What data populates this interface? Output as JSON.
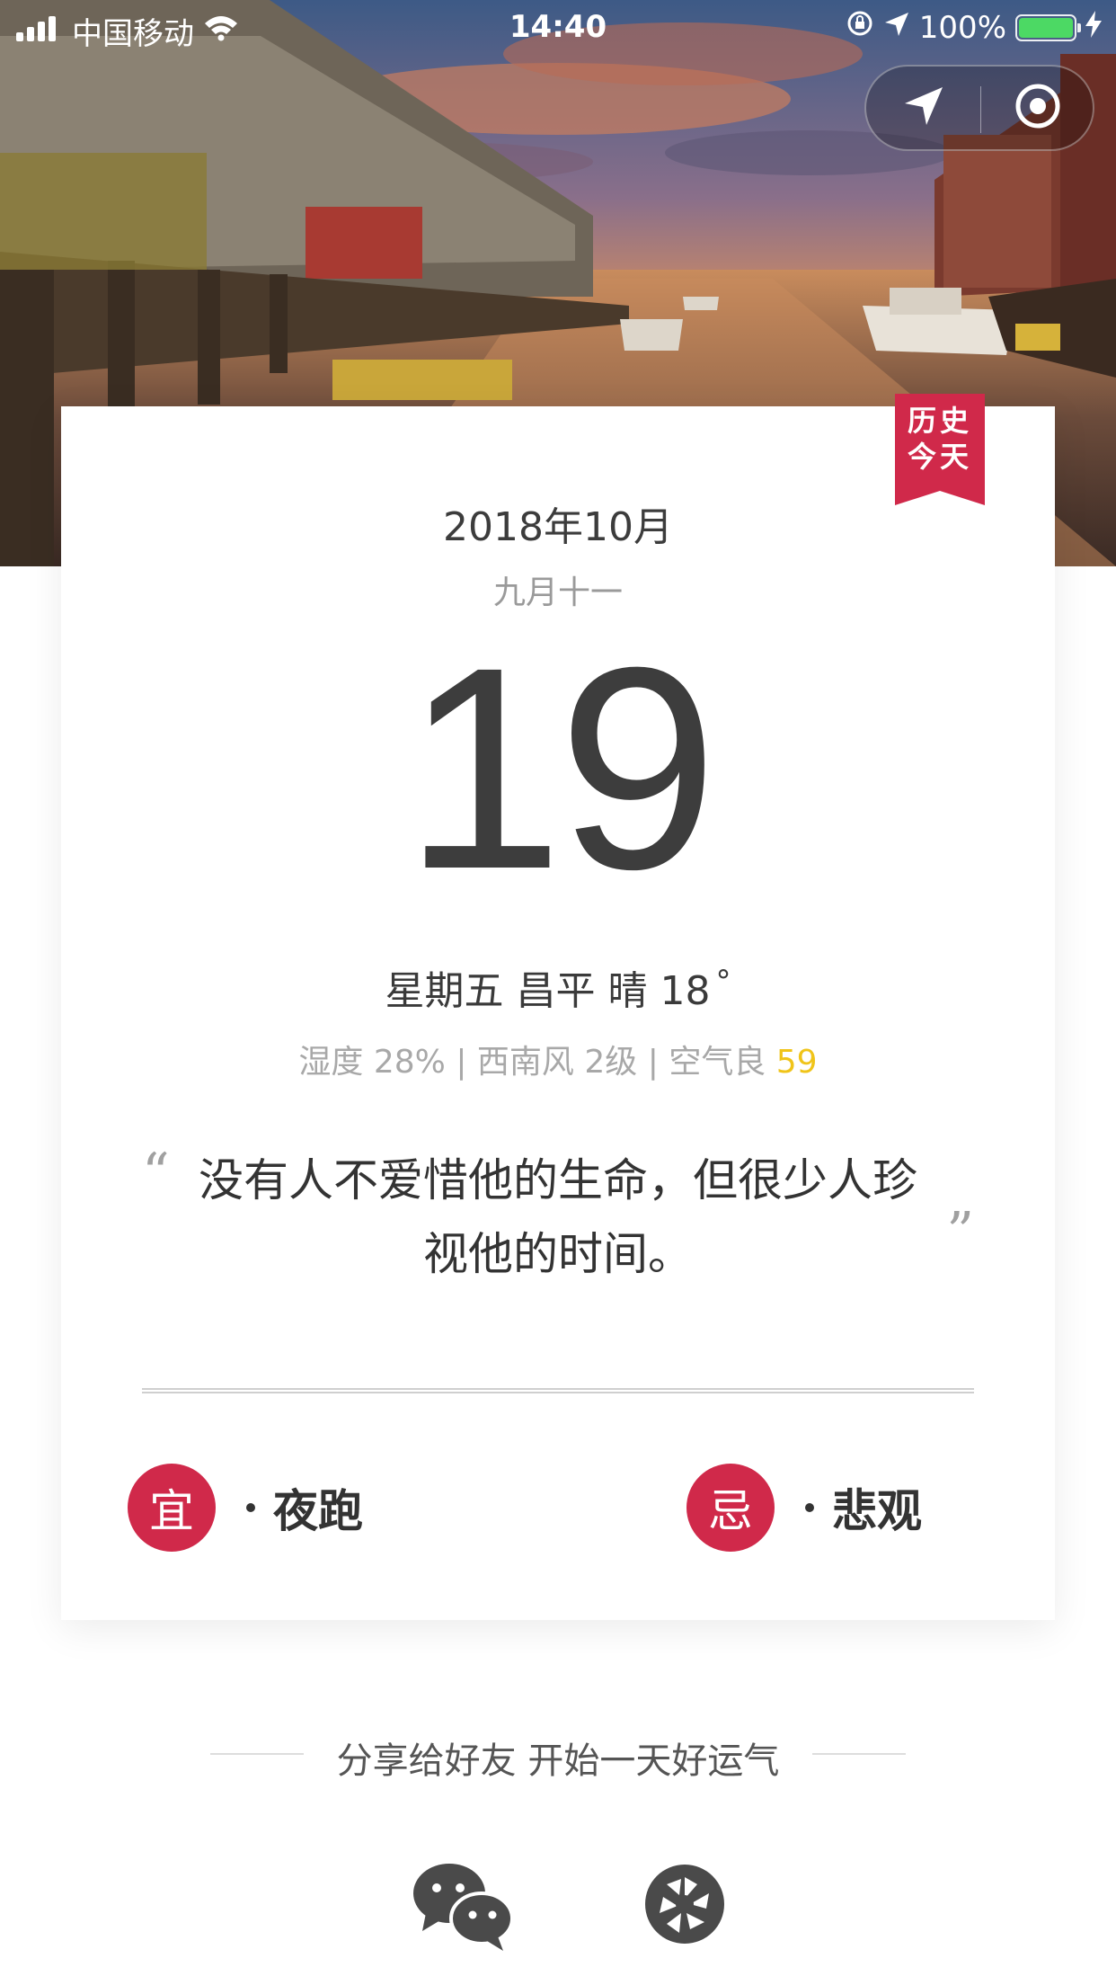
{
  "status_bar": {
    "carrier": "中国移动",
    "time": "14:40",
    "battery_percent": "100%",
    "battery_level": 1.0,
    "battery_color": "#4cd964"
  },
  "capsule": {
    "left_icon": "location-arrow-icon",
    "right_icon": "target-icon"
  },
  "ribbon": {
    "line1": "历史",
    "line2": "今天",
    "color": "#d0294a"
  },
  "calendar": {
    "month": "2018年10月",
    "lunar": "九月十一",
    "day": "19",
    "weekday": "星期五",
    "city": "昌平",
    "weather": "晴",
    "temperature": "18",
    "degree": "°",
    "humidity": "湿度 28%",
    "wind": "西南风 2级",
    "air_label": "空气良",
    "aqi": "59",
    "aqi_color": "#f0c419",
    "separator": "|"
  },
  "quote": {
    "open_mark": "“",
    "text": "没有人不爱惜他的生命，但很少人珍视他的时间。",
    "close_mark": "”"
  },
  "yi": {
    "seal": "宜",
    "activity": "夜跑"
  },
  "ji": {
    "seal": "忌",
    "activity": "悲观"
  },
  "share": {
    "text": "分享给好友 开始一天好运气",
    "icons": [
      "wechat-icon",
      "moments-icon"
    ]
  },
  "accent_color": "#d0294a"
}
